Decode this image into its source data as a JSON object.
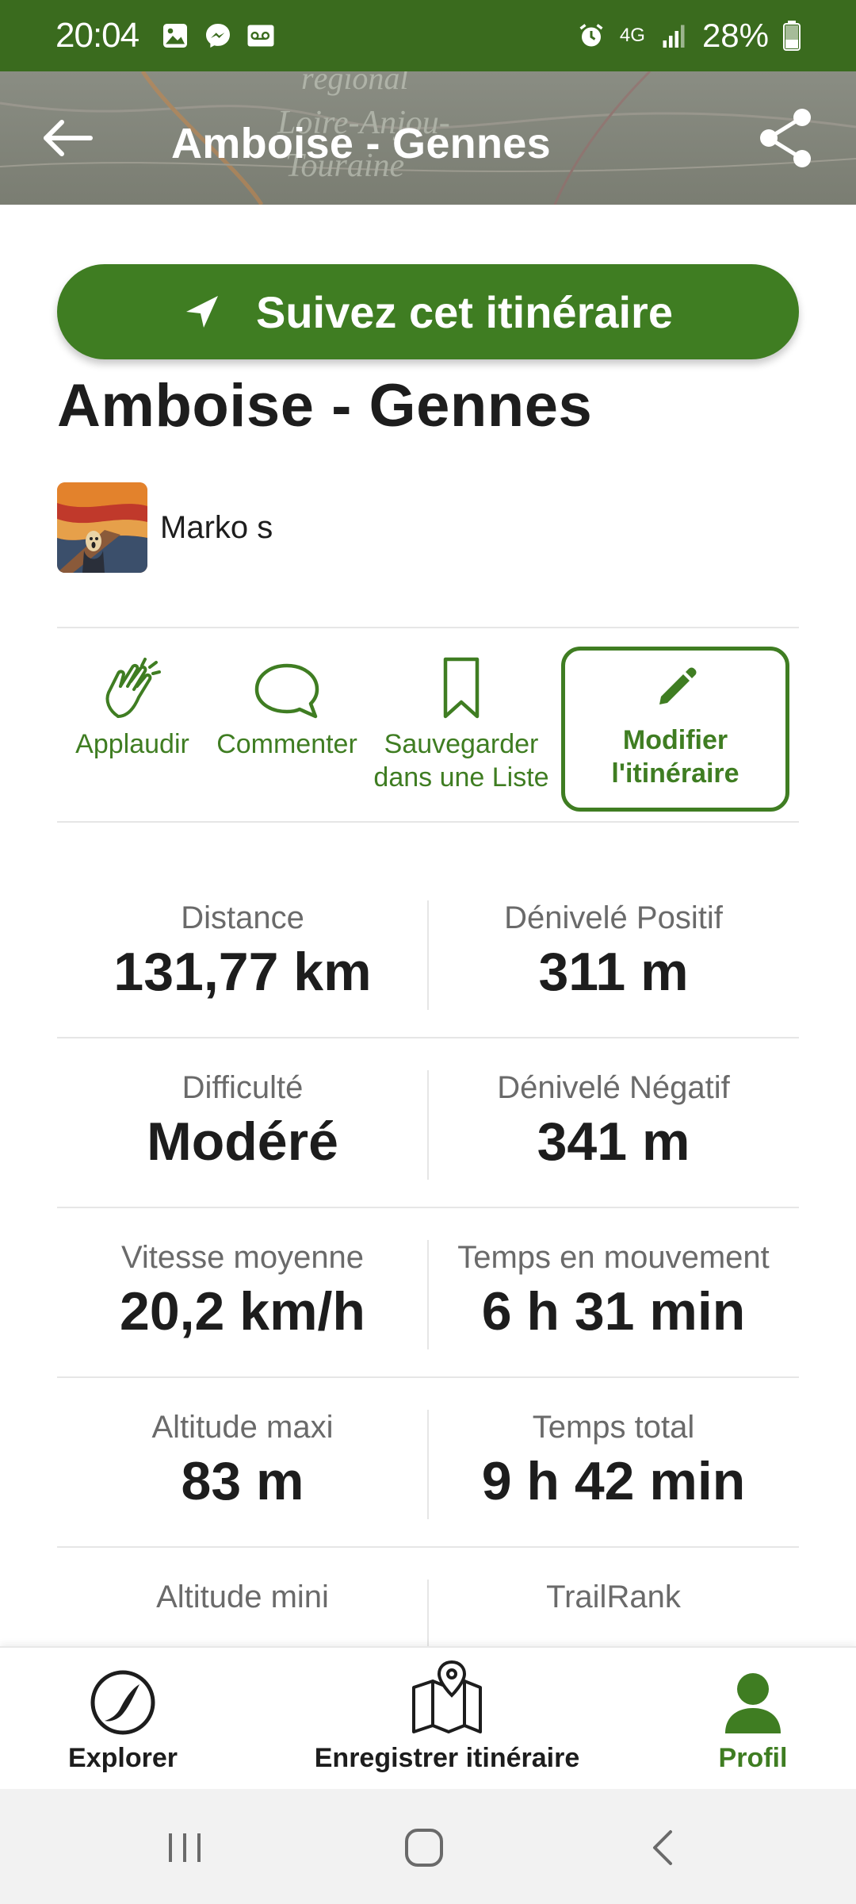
{
  "status_bar": {
    "time": "20:04",
    "network": "4G",
    "battery": "28%",
    "icons_left": [
      "gallery-icon",
      "messenger-icon",
      "voicemail-icon"
    ],
    "icons_right": [
      "alarm-icon",
      "network-4g-icon",
      "signal-icon",
      "battery-icon"
    ]
  },
  "header": {
    "title": "Amboise - Gennes",
    "back_icon": "arrow-left-icon",
    "share_icon": "share-icon"
  },
  "follow_button": {
    "label": "Suivez cet itinéraire",
    "icon": "navigation-arrow-icon"
  },
  "route": {
    "title": "Amboise - Gennes",
    "author": "Marko s"
  },
  "actions": [
    {
      "label": "Applaudir",
      "icon": "clapping-hands-icon"
    },
    {
      "label": "Commenter",
      "icon": "speech-bubble-icon"
    },
    {
      "label": "Sauvegarder dans une Liste",
      "icon": "bookmark-icon"
    },
    {
      "label": "Modifier l'itinéraire",
      "icon": "pencil-icon"
    }
  ],
  "stats": [
    {
      "left": {
        "label": "Distance",
        "value": "131,77 km"
      },
      "right": {
        "label": "Dénivelé Positif",
        "value": "311 m"
      }
    },
    {
      "left": {
        "label": "Difficulté",
        "value": "Modéré"
      },
      "right": {
        "label": "Dénivelé Négatif",
        "value": "341 m"
      }
    },
    {
      "left": {
        "label": "Vitesse moyenne",
        "value": "20,2 km/h"
      },
      "right": {
        "label": "Temps en mouvement",
        "value": "6 h 31 min"
      }
    },
    {
      "left": {
        "label": "Altitude maxi",
        "value": "83 m"
      },
      "right": {
        "label": "Temps total",
        "value": "9 h 42 min"
      }
    },
    {
      "left": {
        "label": "Altitude mini",
        "value": ""
      },
      "right": {
        "label": "TrailRank",
        "value": ""
      }
    }
  ],
  "bottom_nav": [
    {
      "label": "Explorer",
      "icon": "explore-icon"
    },
    {
      "label": "Enregistrer itinéraire",
      "icon": "map-pin-icon"
    },
    {
      "label": "Profil",
      "icon": "profile-icon",
      "active": true
    }
  ],
  "colors": {
    "brand_green": "#3f7d22",
    "status_bar": "#3a6b1e",
    "label_gray": "#6a6a6a"
  }
}
